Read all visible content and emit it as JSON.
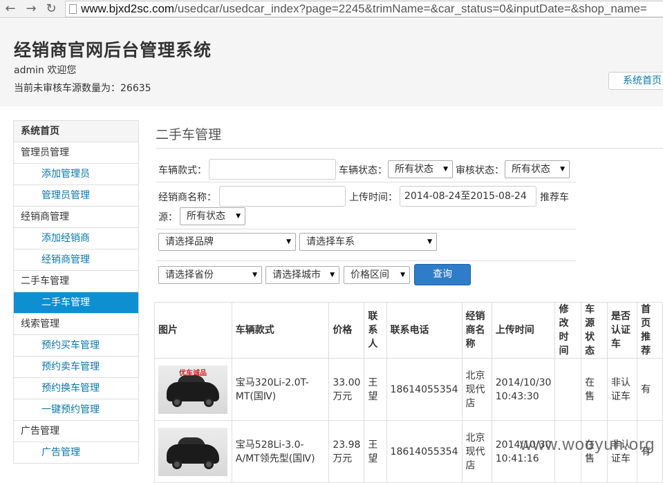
{
  "browser": {
    "url_host": "www.bjxd2sc.com",
    "url_path": "/usedcar/usedcar_index?page=2245&trimName=&car_status=0&inputDate=&shop_name="
  },
  "header": {
    "title": "经销商官网后台管理系统",
    "welcome": "admin 欢迎您",
    "pending": "当前未审核车源数量为：26635",
    "home_button": "系统首页"
  },
  "sidebar": {
    "items": [
      {
        "label": "系统首页"
      },
      {
        "label": "管理员管理"
      },
      {
        "label": "添加管理员"
      },
      {
        "label": "管理员管理"
      },
      {
        "label": "经销商管理"
      },
      {
        "label": "添加经销商"
      },
      {
        "label": "经销商管理"
      },
      {
        "label": "二手车管理"
      },
      {
        "label": "二手车管理"
      },
      {
        "label": "线索管理"
      },
      {
        "label": "预约买车管理"
      },
      {
        "label": "预约卖车管理"
      },
      {
        "label": "预约换车管理"
      },
      {
        "label": "一键预约管理"
      },
      {
        "label": "广告管理"
      },
      {
        "label": "广告管理"
      }
    ]
  },
  "main": {
    "title": "二手车管理",
    "filters": {
      "model_label": "车辆款式：",
      "status_label": "车辆状态：",
      "status_value": "所有状态",
      "audit_label": "审核状态：",
      "audit_value": "所有状态",
      "dealer_label": "经销商名称：",
      "upload_label": "上传时间：",
      "upload_value": "2014-08-24至2015-08-24",
      "recommend_label_1": "推荐车",
      "recommend_label_2": "源：",
      "recommend_value": "所有状态",
      "brand_value": "请选择品牌",
      "series_value": "请选择车系",
      "province_value": "请选择省份",
      "city_value": "请选择城市",
      "price_value": "价格区间",
      "query_button": "查询"
    },
    "table": {
      "headers": [
        "图片",
        "车辆款式",
        "价格",
        "联系人",
        "联系电话",
        "经销商名称",
        "上传时间",
        "修改时间",
        "车源状态",
        "是否认证车",
        "首页推荐"
      ],
      "rows": [
        {
          "thumb_brand": "优车诚品",
          "model": "宝马320Li-2.0T-MT(国Ⅳ)",
          "price": "33.00万元",
          "contact": "王望",
          "phone": "18614055354",
          "dealer": "北京现代店",
          "upload": "2014/10/30 10:43:30",
          "modified": "",
          "status": "在售",
          "certified": "非认证车",
          "recommend": "有"
        },
        {
          "thumb_brand": "",
          "model": "宝马528Li-3.0-A/MT领先型(国Ⅳ)",
          "price": "23.98万元",
          "contact": "王望",
          "phone": "18614055354",
          "dealer": "北京现代店",
          "upload": "2014/10/30 10:41:16",
          "modified": "",
          "status": "在售",
          "certified": "非认证车",
          "recommend": "有"
        }
      ]
    }
  },
  "watermark": "www.wooyun.org"
}
